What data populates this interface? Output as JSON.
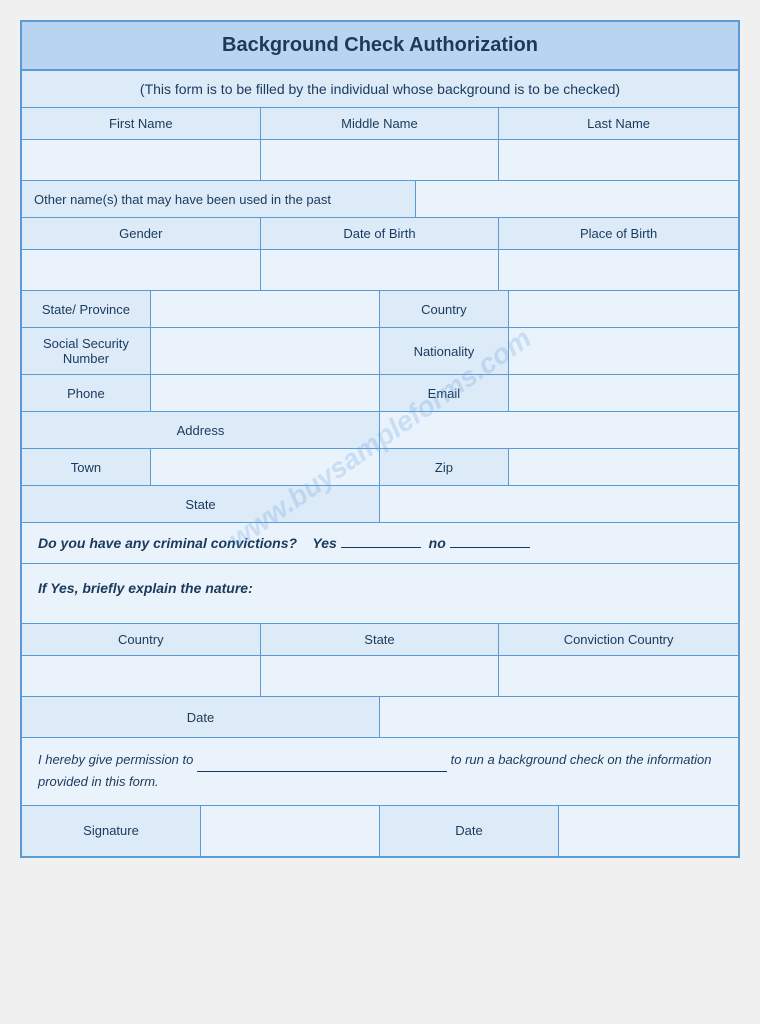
{
  "title": "Background Check Authorization",
  "subtitle": "(This form is to be filled by the individual whose background is to be checked)",
  "headers": {
    "first_name": "First Name",
    "middle_name": "Middle Name",
    "last_name": "Last Name",
    "other_names": "Other name(s) that may have been used in the past",
    "gender": "Gender",
    "dob": "Date of Birth",
    "place_of_birth": "Place of Birth",
    "state_province": "State/ Province",
    "country": "Country",
    "ssn": "Social Security Number",
    "nationality": "Nationality",
    "phone": "Phone",
    "email": "Email",
    "address": "Address",
    "town": "Town",
    "zip": "Zip",
    "state2": "State",
    "conviction_question": "Do you have any criminal convictions?",
    "yes_label": "Yes",
    "no_label": "no",
    "explain_label": "If Yes, briefly explain the nature:",
    "country_col": "Country",
    "state_col": "State",
    "conviction_country_col": "Conviction Country",
    "date_col": "Date",
    "permission_text1": "I hereby give permission to",
    "permission_text2": "to run a background check on the information provided in this form.",
    "signature": "Signature",
    "date_sig": "Date",
    "watermark": "www.buysampleforms.com"
  }
}
